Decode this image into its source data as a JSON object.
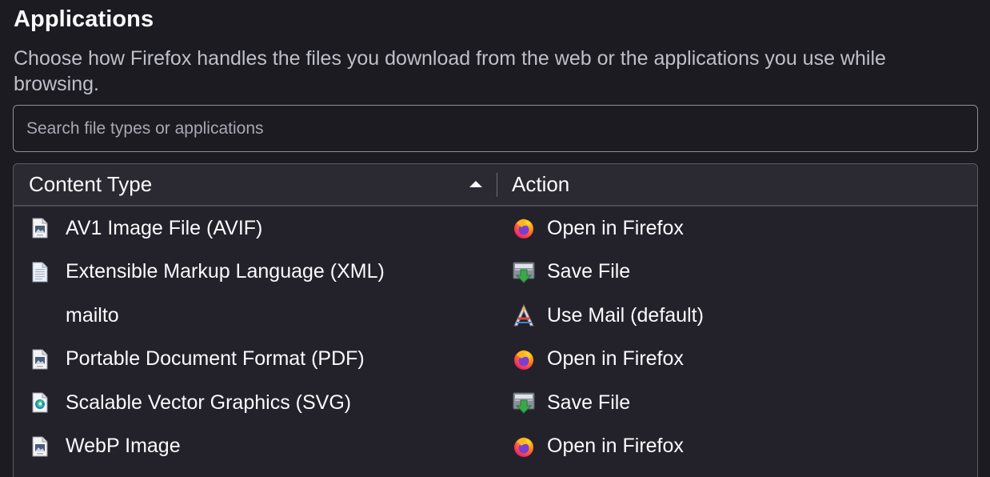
{
  "section": {
    "title": "Applications",
    "description": "Choose how Firefox handles the files you download from the web or the applications you use while browsing."
  },
  "search": {
    "placeholder": "Search file types or applications",
    "value": ""
  },
  "table": {
    "columns": {
      "content_type": "Content Type",
      "action": "Action"
    },
    "sort": {
      "column": "content_type",
      "direction": "ascending"
    },
    "rows": [
      {
        "type": "AV1 Image File (AVIF)",
        "type_icon": "image-file-icon",
        "action": "Open in Firefox",
        "action_icon": "firefox-icon"
      },
      {
        "type": "Extensible Markup Language (XML)",
        "type_icon": "document-file-icon",
        "action": "Save File",
        "action_icon": "save-file-icon"
      },
      {
        "type": "mailto",
        "type_icon": "",
        "action": "Use Mail (default)",
        "action_icon": "mail-app-icon"
      },
      {
        "type": "Portable Document Format (PDF)",
        "type_icon": "pdf-file-icon",
        "action": "Open in Firefox",
        "action_icon": "firefox-icon"
      },
      {
        "type": "Scalable Vector Graphics (SVG)",
        "type_icon": "edge-svg-file-icon",
        "action": "Save File",
        "action_icon": "save-file-icon"
      },
      {
        "type": "WebP Image",
        "type_icon": "image-file-icon",
        "action": "Open in Firefox",
        "action_icon": "firefox-icon"
      }
    ]
  }
}
